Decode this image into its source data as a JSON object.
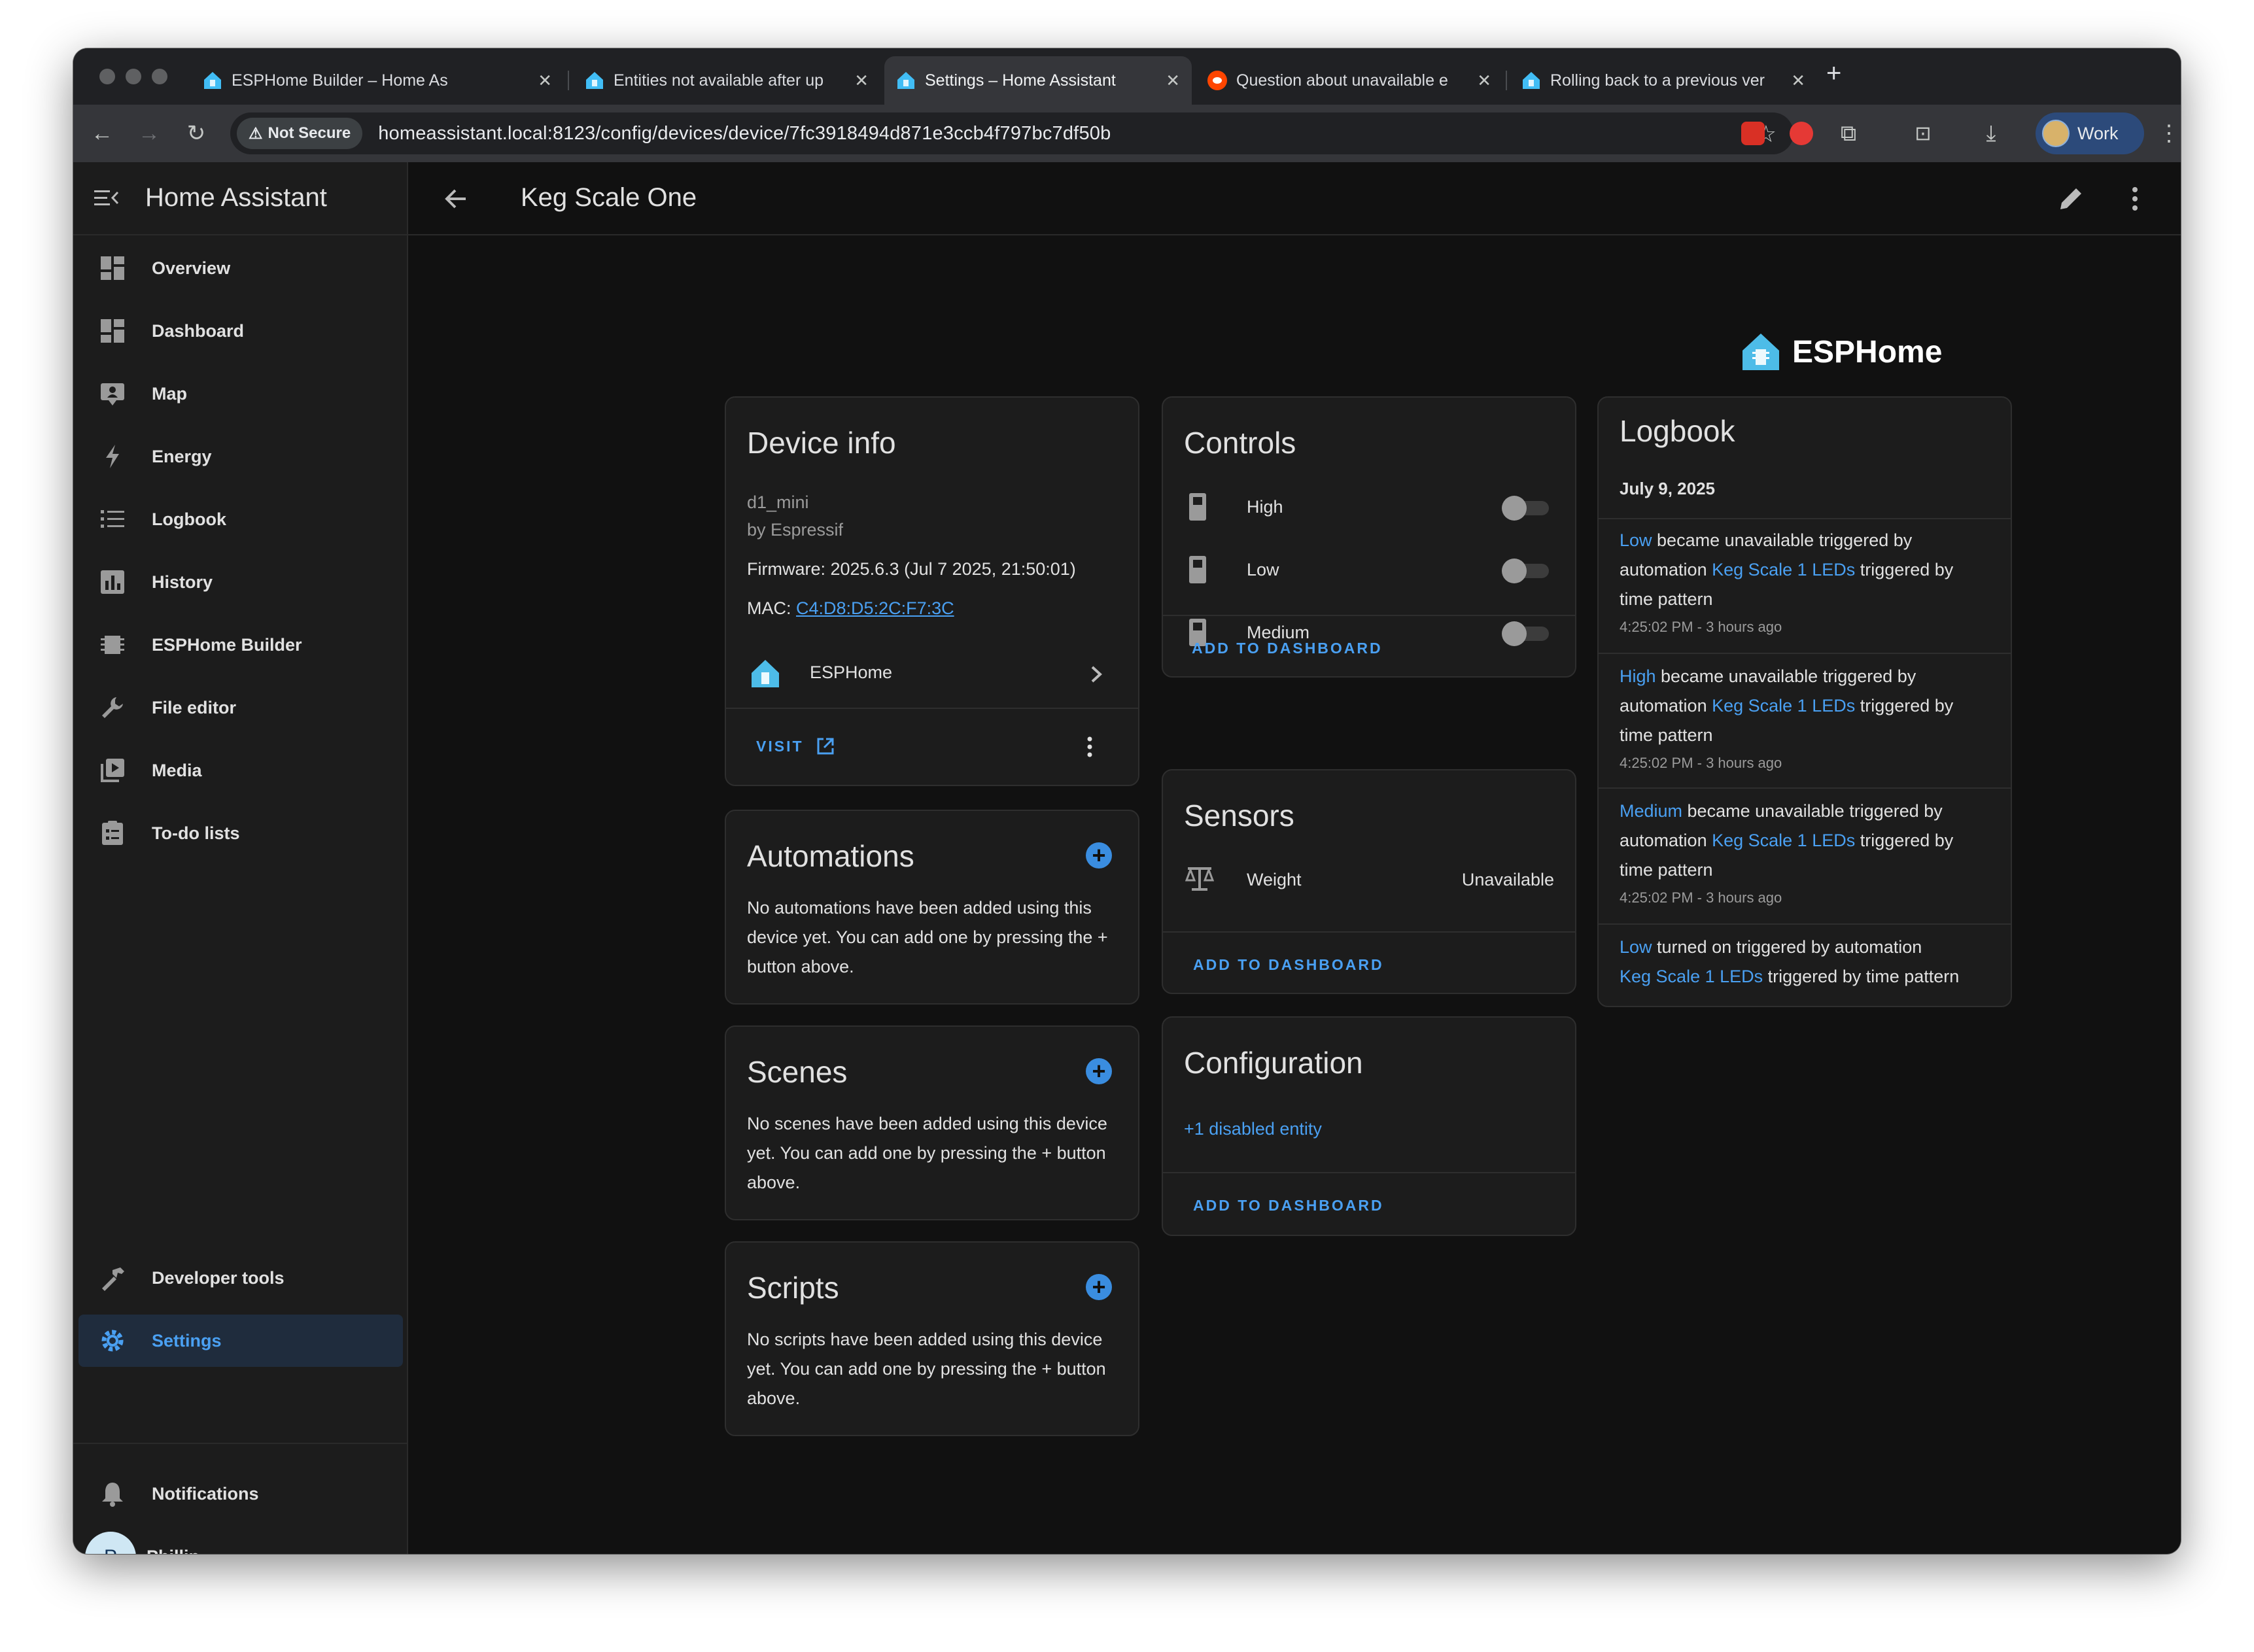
{
  "browser": {
    "tabs": [
      {
        "title": "ESPHome Builder – Home As",
        "favicon": "home-assistant-icon"
      },
      {
        "title": "Entities not available after up",
        "favicon": "home-assistant-icon"
      },
      {
        "title": "Settings – Home Assistant",
        "favicon": "home-assistant-icon",
        "active": true
      },
      {
        "title": "Question about unavailable e",
        "favicon": "reddit-icon"
      },
      {
        "title": "Rolling back to a previous ver",
        "favicon": "home-assistant-icon"
      }
    ],
    "security_label": "Not Secure",
    "url": "homeassistant.local:8123/config/devices/device/7fc3918494d871e3ccb4f797bc7df50b",
    "profile_label": "Work"
  },
  "sidebar": {
    "title": "Home Assistant",
    "items": [
      {
        "label": "Overview",
        "icon": "overview-icon"
      },
      {
        "label": "Dashboard",
        "icon": "dashboard-icon"
      },
      {
        "label": "Map",
        "icon": "map-icon"
      },
      {
        "label": "Energy",
        "icon": "energy-icon"
      },
      {
        "label": "Logbook",
        "icon": "logbook-icon"
      },
      {
        "label": "History",
        "icon": "history-icon"
      },
      {
        "label": "ESPHome Builder",
        "icon": "esphome-icon"
      },
      {
        "label": "File editor",
        "icon": "wrench-icon"
      },
      {
        "label": "Media",
        "icon": "media-icon"
      },
      {
        "label": "To-do lists",
        "icon": "todo-icon"
      }
    ],
    "developer_tools": "Developer tools",
    "settings": "Settings",
    "notifications": "Notifications",
    "user": {
      "initial": "P",
      "name": "Phillip"
    }
  },
  "page": {
    "title": "Keg Scale One",
    "integration_brand": "ESPHome"
  },
  "device_info": {
    "title": "Device info",
    "model": "d1_mini",
    "manufacturer": "by Espressif",
    "firmware": "Firmware: 2025.6.3 (Jul 7 2025, 21:50:01)",
    "mac_label": "MAC: ",
    "mac": "C4:D8:D5:2C:F7:3C",
    "integration": "ESPHome",
    "visit_label": "VISIT"
  },
  "automations": {
    "title": "Automations",
    "empty_text": [
      "No automations have been added using this",
      "device yet. You can add one by pressing the +",
      "button above."
    ]
  },
  "scenes": {
    "title": "Scenes",
    "empty_text": [
      "No scenes have been added using this device",
      "yet. You can add one by pressing the + button",
      "above."
    ]
  },
  "scripts": {
    "title": "Scripts",
    "empty_text": [
      "No scripts have been added using this device",
      "yet. You can add one by pressing the + button",
      "above."
    ]
  },
  "controls": {
    "title": "Controls",
    "items": [
      {
        "label": "High",
        "state": "off"
      },
      {
        "label": "Low",
        "state": "off"
      },
      {
        "label": "Medium",
        "state": "off"
      }
    ],
    "add_label": "ADD TO DASHBOARD"
  },
  "sensors": {
    "title": "Sensors",
    "items": [
      {
        "label": "Weight",
        "value": "Unavailable"
      }
    ],
    "add_label": "ADD TO DASHBOARD"
  },
  "configuration": {
    "title": "Configuration",
    "disabled_link": "+1 disabled entity",
    "add_label": "ADD TO DASHBOARD"
  },
  "logbook": {
    "title": "Logbook",
    "date": "July 9, 2025",
    "entries": [
      {
        "entity": "Low",
        "text_a": " became unavailable triggered by",
        "text_b": "automation ",
        "automation": "Keg Scale 1 LEDs",
        "text_c": " triggered by",
        "text_d": "time pattern",
        "time": "4:25:02 PM - 3 hours ago"
      },
      {
        "entity": "High",
        "text_a": " became unavailable triggered by",
        "text_b": "automation ",
        "automation": "Keg Scale 1 LEDs",
        "text_c": " triggered by",
        "text_d": "time pattern",
        "time": "4:25:02 PM - 3 hours ago"
      },
      {
        "entity": "Medium",
        "text_a": " became unavailable triggered by",
        "text_b": "automation ",
        "automation": "Keg Scale 1 LEDs",
        "text_c": " triggered by",
        "text_d": "time pattern",
        "time": "4:25:02 PM - 3 hours ago"
      }
    ],
    "last_entry": {
      "entity": "Low",
      "text_a": " turned on triggered by automation",
      "automation": "Keg Scale 1 LEDs",
      "text_b": " triggered by time pattern"
    }
  },
  "colors": {
    "accent": "#4aa0f2",
    "background": "#111111",
    "card": "#1c1c1c",
    "text": "#e1e1e1",
    "esphome": "#4dbce8"
  }
}
